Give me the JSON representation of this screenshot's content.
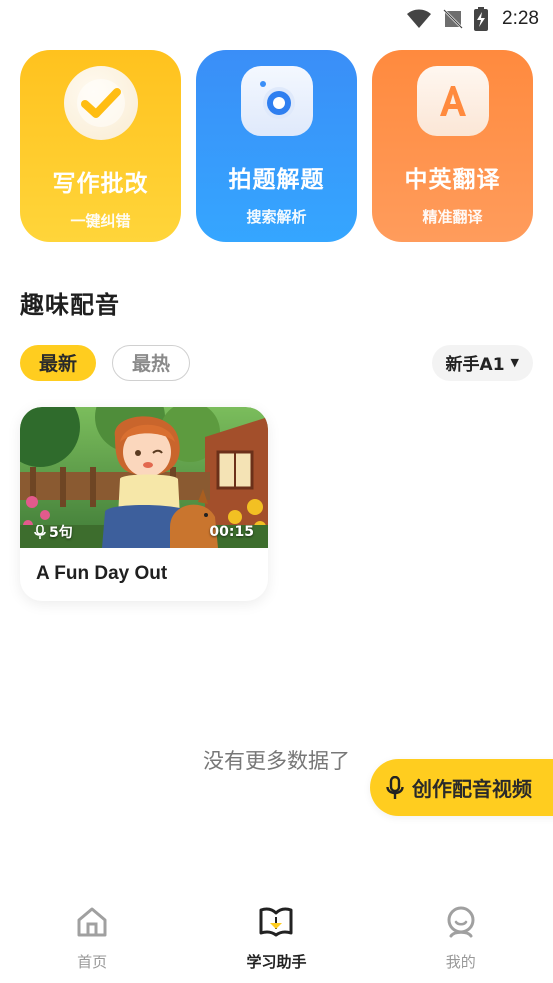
{
  "status_bar": {
    "time": "2:28",
    "icons": [
      "wifi-icon",
      "no-signal-icon",
      "battery-charging-icon"
    ]
  },
  "features": [
    {
      "title": "写作批改",
      "subtitle": "一键纠错",
      "icon": "checkmark-icon",
      "color": "#ffc21e"
    },
    {
      "title": "拍题解题",
      "subtitle": "搜索解析",
      "icon": "camera-icon",
      "color": "#3a8ef7"
    },
    {
      "title": "中英翻译",
      "subtitle": "精准翻译",
      "icon": "letter-a-icon",
      "color": "#ff8a3e"
    }
  ],
  "section": {
    "title": "趣味配音"
  },
  "filters": {
    "tabs": [
      {
        "label": "最新",
        "active": true
      },
      {
        "label": "最热",
        "active": false
      }
    ],
    "level": "新手A1"
  },
  "videos": [
    {
      "title": "A Fun Day Out",
      "sentences": "5句",
      "duration": "00:15"
    }
  ],
  "empty_text": "没有更多数据了",
  "fab": {
    "label": "创作配音视频",
    "icon": "microphone-icon"
  },
  "nav": [
    {
      "label": "首页",
      "icon": "home-icon",
      "active": false
    },
    {
      "label": "学习助手",
      "icon": "book-icon",
      "active": true
    },
    {
      "label": "我的",
      "icon": "profile-icon",
      "active": false
    }
  ],
  "accent_color": "#ffcd1f"
}
